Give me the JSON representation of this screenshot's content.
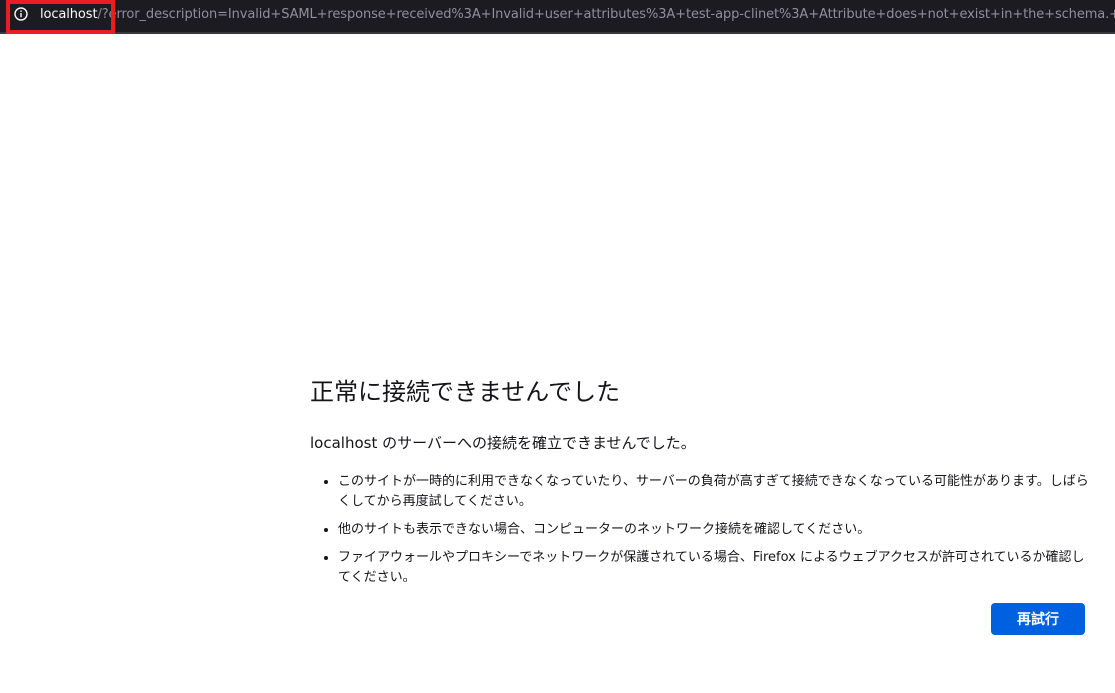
{
  "urlbar": {
    "host": "localhost",
    "rest": "/?error_description=Invalid+SAML+response+received%3A+Invalid+user+attributes%3A+test-app-clinet%3A+Attribute+does+not+exist+in+the+schema.+&error=ser",
    "icon": "info-icon"
  },
  "error_page": {
    "title": "正常に接続できませんでした",
    "lead": "localhost のサーバーへの接続を確立できませんでした。",
    "bullets": [
      "このサイトが一時的に利用できなくなっていたり、サーバーの負荷が高すぎて接続できなくなっている可能性があります。しばらくしてから再度試してください。",
      "他のサイトも表示できない場合、コンピューターのネットワーク接続を確認してください。",
      "ファイアウォールやプロキシーでネットワークが保護されている場合、Firefox によるウェブアクセスが許可されているか確認してください。"
    ],
    "retry_label": "再試行"
  },
  "colors": {
    "urlbar_bg": "#1c1b22",
    "highlight": "#ea1c24",
    "button": "#0061e0"
  }
}
